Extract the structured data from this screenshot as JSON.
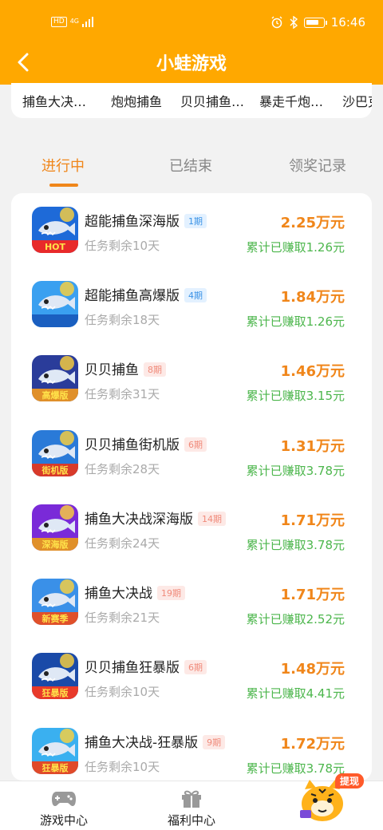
{
  "status_bar": {
    "time": "16:46",
    "hd": "HD",
    "network": "4G"
  },
  "header": {
    "title": "小蛙游戏"
  },
  "categories": [
    "捕鱼大决…",
    "炮炮捕鱼",
    "贝贝捕鱼…",
    "暴走千炮…",
    "沙巴克"
  ],
  "tabs": [
    "进行中",
    "已结束",
    "领奖记录"
  ],
  "games": [
    {
      "name": "超能捕鱼深海版",
      "period": "1期",
      "remain": "任务剩余10天",
      "reward": "2.25万元",
      "earned": "累计已赚取1.26元",
      "badge_color": "blue",
      "icon_text": "HOT"
    },
    {
      "name": "超能捕鱼高爆版",
      "period": "4期",
      "remain": "任务剩余18天",
      "reward": "1.84万元",
      "earned": "累计已赚取1.26元",
      "badge_color": "blue",
      "icon_text": ""
    },
    {
      "name": "贝贝捕鱼",
      "period": "8期",
      "remain": "任务剩余31天",
      "reward": "1.46万元",
      "earned": "累计已赚取3.15元",
      "badge_color": "pink",
      "icon_text": "高爆版"
    },
    {
      "name": "贝贝捕鱼街机版",
      "period": "6期",
      "remain": "任务剩余28天",
      "reward": "1.31万元",
      "earned": "累计已赚取3.78元",
      "badge_color": "pink",
      "icon_text": "街机版"
    },
    {
      "name": "捕鱼大决战深海版",
      "period": "14期",
      "remain": "任务剩余24天",
      "reward": "1.71万元",
      "earned": "累计已赚取3.78元",
      "badge_color": "pink",
      "icon_text": "深海版"
    },
    {
      "name": "捕鱼大决战",
      "period": "19期",
      "remain": "任务剩余21天",
      "reward": "1.71万元",
      "earned": "累计已赚取2.52元",
      "badge_color": "pink",
      "icon_text": "新赛季"
    },
    {
      "name": "贝贝捕鱼狂暴版",
      "period": "6期",
      "remain": "任务剩余10天",
      "reward": "1.48万元",
      "earned": "累计已赚取4.41元",
      "badge_color": "pink",
      "icon_text": "狂暴版"
    },
    {
      "name": "捕鱼大决战-狂暴版",
      "period": "9期",
      "remain": "任务剩余10天",
      "reward": "1.72万元",
      "earned": "累计已赚取3.78元",
      "badge_color": "pink",
      "icon_text": "狂暴版"
    }
  ],
  "bottom_nav": [
    {
      "label": "游戏中心",
      "icon": "gamepad-icon"
    },
    {
      "label": "福利中心",
      "icon": "gift-icon"
    }
  ],
  "withdraw_label": "提现",
  "colors": {
    "header": "#ffa800",
    "accent": "#f0861a",
    "earned": "#4cb64c"
  }
}
